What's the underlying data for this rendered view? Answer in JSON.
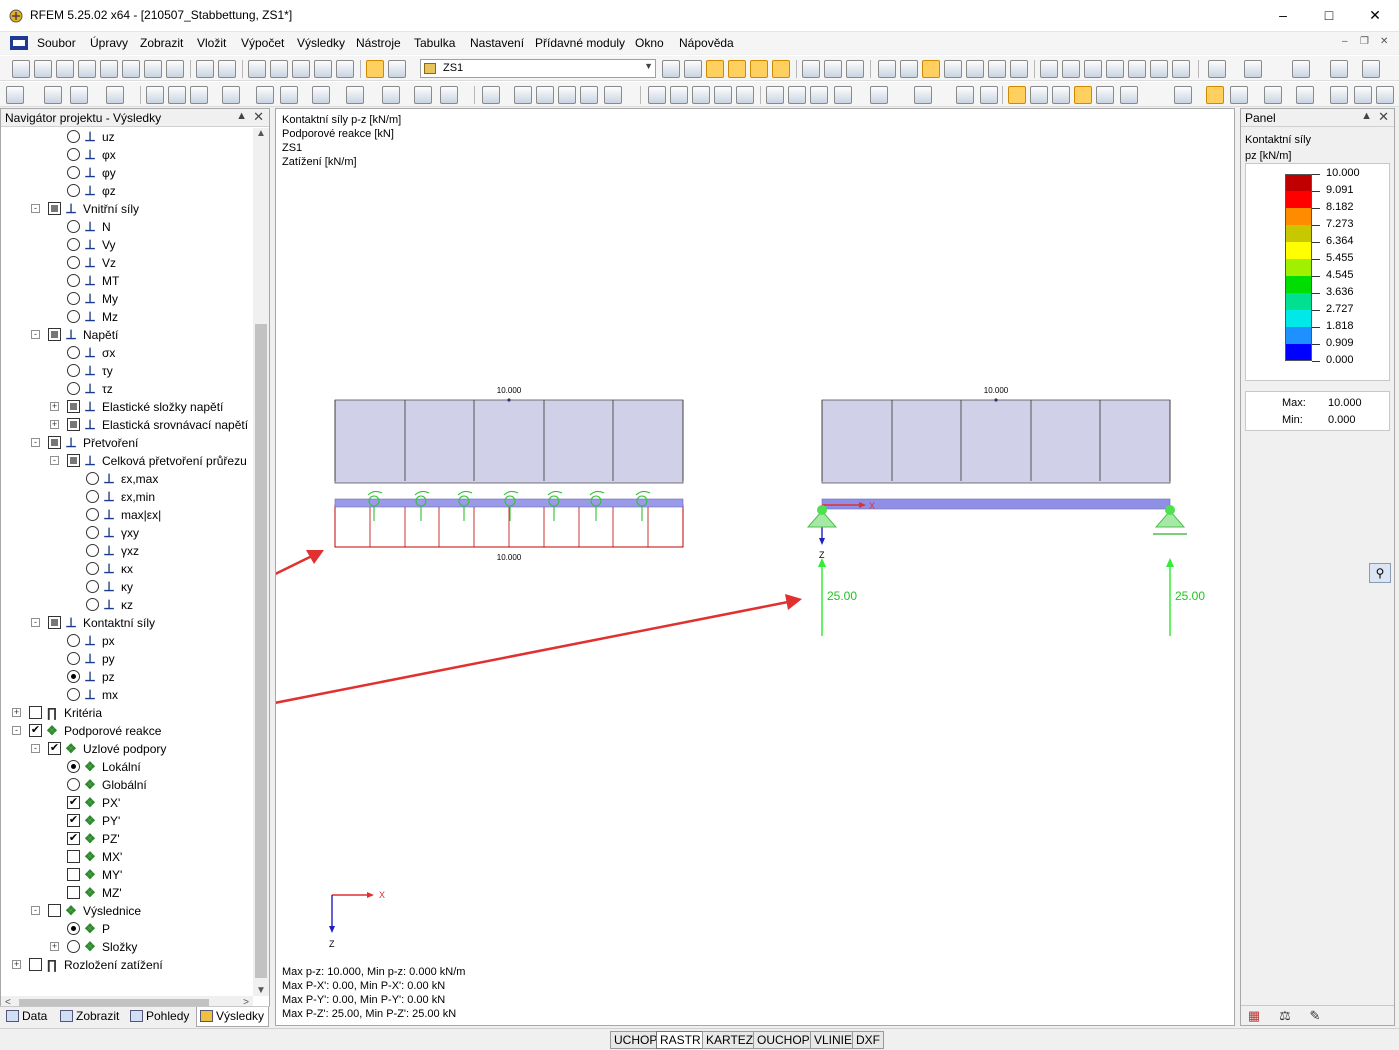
{
  "window": {
    "title": "RFEM 5.25.02 x64 - [210507_Stabbettung, ZS1*]"
  },
  "menu": [
    "Soubor",
    "Úpravy",
    "Zobrazit",
    "Vložit",
    "Výpočet",
    "Výsledky",
    "Nástroje",
    "Tabulka",
    "Nastavení",
    "Přídavné moduly",
    "Okno",
    "Nápověda"
  ],
  "toolbar": {
    "load_case": "ZS1"
  },
  "navigator": {
    "title": "Navigátor projektu - Výsledky",
    "tree": [
      {
        "label": "uz",
        "level": 3,
        "ctl": "radio",
        "icon": "deformation"
      },
      {
        "label": "φx",
        "level": 3,
        "ctl": "radio",
        "icon": "deformation"
      },
      {
        "label": "φy",
        "level": 3,
        "ctl": "radio",
        "icon": "deformation"
      },
      {
        "label": "φz",
        "level": 3,
        "ctl": "radio",
        "icon": "deformation"
      },
      {
        "label": "Vnitřní síly",
        "level": 2,
        "ctl": "checkbox-indeterminate",
        "exp": "-",
        "icon": "member"
      },
      {
        "label": "N",
        "level": 3,
        "ctl": "radio",
        "icon": "force-n"
      },
      {
        "label": "Vy",
        "level": 3,
        "ctl": "radio",
        "icon": "force-vy"
      },
      {
        "label": "Vz",
        "level": 3,
        "ctl": "radio",
        "icon": "force-vz"
      },
      {
        "label": "MT",
        "level": 3,
        "ctl": "radio",
        "icon": "moment-mt"
      },
      {
        "label": "My",
        "level": 3,
        "ctl": "radio",
        "icon": "moment-my"
      },
      {
        "label": "Mz",
        "level": 3,
        "ctl": "radio",
        "icon": "moment-mz"
      },
      {
        "label": "Napětí",
        "level": 2,
        "ctl": "checkbox-indeterminate",
        "exp": "-",
        "icon": "member"
      },
      {
        "label": "σx",
        "level": 3,
        "ctl": "radio",
        "icon": "stress"
      },
      {
        "label": "τy",
        "level": 3,
        "ctl": "radio",
        "icon": "stress"
      },
      {
        "label": "τz",
        "level": 3,
        "ctl": "radio",
        "icon": "stress"
      },
      {
        "label": "Elastické složky napětí",
        "level": 3,
        "ctl": "checkbox-indeterminate",
        "exp": "+",
        "icon": "stress"
      },
      {
        "label": "Elastická srovnávací napětí",
        "level": 3,
        "ctl": "checkbox-indeterminate",
        "exp": "+",
        "icon": "stress"
      },
      {
        "label": "Přetvoření",
        "level": 2,
        "ctl": "checkbox-indeterminate",
        "exp": "-",
        "icon": "member"
      },
      {
        "label": "Celková přetvoření průřezu",
        "level": 3,
        "ctl": "checkbox-indeterminate",
        "exp": "-",
        "icon": "strain"
      },
      {
        "label": "εx,max",
        "level": 4,
        "ctl": "radio",
        "icon": "strain"
      },
      {
        "label": "εx,min",
        "level": 4,
        "ctl": "radio",
        "icon": "strain"
      },
      {
        "label": "max|εx|",
        "level": 4,
        "ctl": "radio",
        "icon": "strain"
      },
      {
        "label": "γxy",
        "level": 4,
        "ctl": "radio",
        "icon": "strain"
      },
      {
        "label": "γxz",
        "level": 4,
        "ctl": "radio",
        "icon": "strain"
      },
      {
        "label": "κx",
        "level": 4,
        "ctl": "radio",
        "icon": "strain"
      },
      {
        "label": "κy",
        "level": 4,
        "ctl": "radio",
        "icon": "strain"
      },
      {
        "label": "κz",
        "level": 4,
        "ctl": "radio",
        "icon": "strain"
      },
      {
        "label": "Kontaktní síly",
        "level": 2,
        "ctl": "checkbox-indeterminate",
        "exp": "-",
        "icon": "member"
      },
      {
        "label": "px",
        "level": 3,
        "ctl": "radio",
        "icon": "contact-px"
      },
      {
        "label": "py",
        "level": 3,
        "ctl": "radio",
        "icon": "contact-py"
      },
      {
        "label": "pz",
        "level": 3,
        "ctl": "radio-on",
        "icon": "contact-pz"
      },
      {
        "label": "mx",
        "level": 3,
        "ctl": "radio",
        "icon": "contact-mx"
      },
      {
        "label": "Kritéria",
        "level": 1,
        "ctl": "checkbox",
        "exp": "+",
        "icon": "criteria"
      },
      {
        "label": "Podporové reakce",
        "level": 1,
        "ctl": "checkbox-on",
        "exp": "-",
        "icon": "support"
      },
      {
        "label": "Uzlové podpory",
        "level": 2,
        "ctl": "checkbox-on",
        "exp": "-",
        "icon": "support"
      },
      {
        "label": "Lokální",
        "level": 3,
        "ctl": "radio-on",
        "icon": "support"
      },
      {
        "label": "Globální",
        "level": 3,
        "ctl": "radio",
        "icon": "support"
      },
      {
        "label": "PX'",
        "level": 3,
        "ctl": "checkbox-on",
        "icon": "support"
      },
      {
        "label": "PY'",
        "level": 3,
        "ctl": "checkbox-on",
        "icon": "support"
      },
      {
        "label": "PZ'",
        "level": 3,
        "ctl": "checkbox-on",
        "icon": "support"
      },
      {
        "label": "MX'",
        "level": 3,
        "ctl": "checkbox",
        "icon": "support"
      },
      {
        "label": "MY'",
        "level": 3,
        "ctl": "checkbox",
        "icon": "support"
      },
      {
        "label": "MZ'",
        "level": 3,
        "ctl": "checkbox",
        "icon": "support"
      },
      {
        "label": "Výslednice",
        "level": 2,
        "ctl": "checkbox",
        "exp": "-",
        "icon": "support"
      },
      {
        "label": "P",
        "level": 3,
        "ctl": "radio-on",
        "icon": "support"
      },
      {
        "label": "Složky",
        "level": 3,
        "ctl": "radio",
        "exp": "+",
        "icon": "support"
      },
      {
        "label": "Rozložení zatížení",
        "level": 1,
        "ctl": "checkbox",
        "exp": "+",
        "icon": "criteria"
      }
    ],
    "tabs": [
      "Data",
      "Zobrazit",
      "Pohledy",
      "Výsledky"
    ]
  },
  "viewport": {
    "info_lines": [
      "Kontaktní síly p-z [kN/m]",
      "Podporové reakce [kN]",
      "ZS1",
      "Zatížení [kN/m]"
    ],
    "beam1": {
      "load_label": "10.000",
      "contact_label": "10.000"
    },
    "beam2": {
      "load_label": "10.000",
      "reaction_left": "25.00",
      "reaction_right": "25.00",
      "axis_x": "X",
      "axis_z": "Z"
    },
    "global_axes": {
      "x": "X",
      "z": "Z"
    },
    "summary_lines": [
      "Max p-z: 10.000, Min p-z: 0.000 kN/m",
      "Max P-X': 0.00, Min P-X': 0.00 kN",
      "Max P-Y': 0.00, Min P-Y': 0.00 kN",
      "Max P-Z': 25.00, Min P-Z': 25.00 kN"
    ],
    "colors": {
      "load": "#d0d0e8",
      "contact": "#c00000",
      "beam": "#8f8fe6",
      "reaction": "#33ee33",
      "arrow": "#e03030"
    }
  },
  "panel": {
    "title": "Panel",
    "subtitle": "Kontaktní síly",
    "unit": "pz [kN/m]",
    "legend": [
      {
        "value": "10.000",
        "color": "#c00000"
      },
      {
        "value": "9.091",
        "color": "#ff0000"
      },
      {
        "value": "8.182",
        "color": "#ff8c00"
      },
      {
        "value": "7.273",
        "color": "#c8c800"
      },
      {
        "value": "6.364",
        "color": "#ffff00"
      },
      {
        "value": "5.455",
        "color": "#a0f000"
      },
      {
        "value": "4.545",
        "color": "#00dd00"
      },
      {
        "value": "3.636",
        "color": "#00e090"
      },
      {
        "value": "2.727",
        "color": "#00e8e8"
      },
      {
        "value": "1.818",
        "color": "#1e90ff"
      },
      {
        "value": "0.909",
        "color": "#0000ff"
      },
      {
        "value": "0.000",
        "color": "#000090"
      }
    ],
    "max_label": "Max:",
    "max_value": "10.000",
    "min_label": "Min:",
    "min_value": "0.000"
  },
  "statusbar": {
    "buttons": [
      "UCHOP",
      "RASTR",
      "KARTEZ",
      "OUCHOP",
      "VLINIE",
      "DXF"
    ]
  }
}
